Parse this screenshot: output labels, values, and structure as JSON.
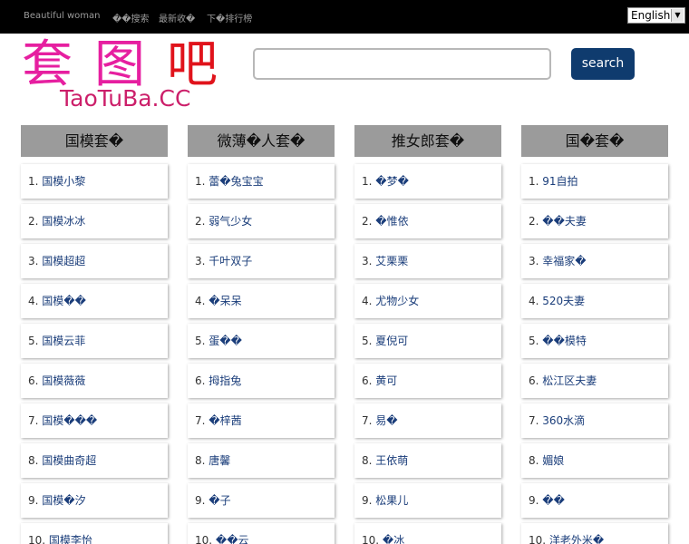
{
  "topbar": {
    "links": [
      "Beautiful woman",
      "��搜索",
      "最新收�",
      "下�排行榜"
    ],
    "language": "English"
  },
  "logo": {
    "chinese": "套图吧",
    "english": "TaoTuBa.CC"
  },
  "search": {
    "placeholder": "",
    "button_label": "search"
  },
  "colors": {
    "logo_magenta": "#e61fa0",
    "logo_red": "#e0131b",
    "button_bg": "#0f3b6e",
    "header_bg": "#9b9b9b",
    "link": "#1a3d7a"
  },
  "columns": [
    {
      "title": "国模套�",
      "items": [
        "国模小黎",
        "国模冰冰",
        "国模超超",
        "国模��",
        "国模云菲",
        "国模薇薇",
        "国模���",
        "国模曲奇超",
        "国模�汐",
        "国模李怡"
      ]
    },
    {
      "title": "微薄�人套�",
      "items": [
        "蕾�兔宝宝",
        "弱气少女",
        "千叶双子",
        "�呆呆",
        "蛋��",
        "拇指兔",
        "�梓茜",
        "唐馨",
        "�子",
        "��云"
      ]
    },
    {
      "title": "推女郎套�",
      "items": [
        "�梦�",
        "�惟依",
        "艾栗栗",
        "尤物少女",
        "夏倪可",
        "黄可",
        "易�",
        "王依萌",
        "松果儿",
        "�冰"
      ]
    },
    {
      "title": "国�套�",
      "items": [
        "91自拍",
        "��夫妻",
        "幸福家�",
        "520夫妻",
        "��模特",
        "松江区夫妻",
        "360水滴",
        "媚娘",
        "��",
        "洋老外米�"
      ]
    }
  ]
}
